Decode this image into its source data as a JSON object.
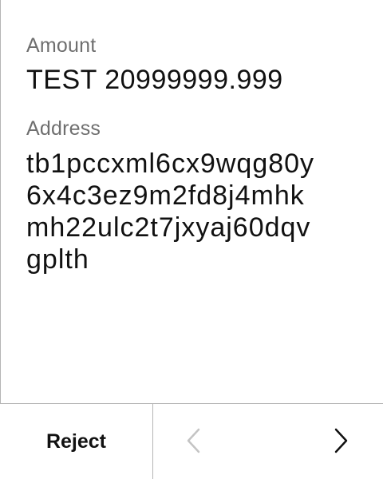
{
  "amount": {
    "label": "Amount",
    "value": "TEST 20999999.999"
  },
  "address": {
    "label": "Address",
    "lines": [
      "tb1pccxml6cx9wqg80y",
      "6x4c3ez9m2fd8j4mhk",
      "mh22ulc2t7jxyaj60dqv",
      "gplth"
    ]
  },
  "actions": {
    "reject_label": "Reject",
    "prev_icon": "chevron-left-icon",
    "next_icon": "chevron-right-icon"
  },
  "colors": {
    "label_gray": "#6f6f6f",
    "text_dark": "#111111",
    "disabled_icon": "#c4c4c4",
    "divider": "#b5b5b5"
  }
}
